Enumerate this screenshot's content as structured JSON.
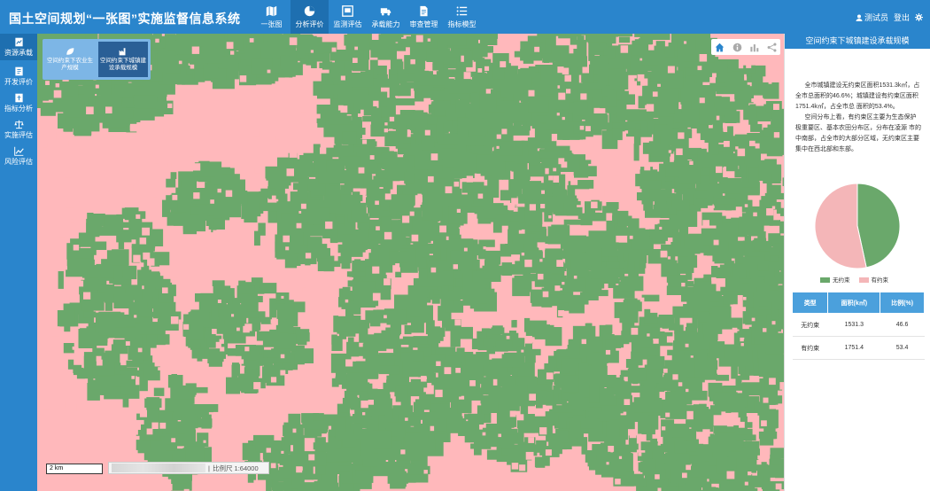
{
  "header": {
    "title": "国土空间规划“一张图”实施监督信息系统",
    "nav": [
      {
        "label": "一张图",
        "icon": "map-icon",
        "active": false
      },
      {
        "label": "分析评价",
        "icon": "pie-chart-icon",
        "active": true
      },
      {
        "label": "监测评估",
        "icon": "monitor-icon",
        "active": false
      },
      {
        "label": "承载能力",
        "icon": "truck-icon",
        "active": false
      },
      {
        "label": "审查管理",
        "icon": "document-icon",
        "active": false
      },
      {
        "label": "指标模型",
        "icon": "list-icon",
        "active": false
      }
    ],
    "user": "测试员",
    "logout": "登出"
  },
  "sidebar": {
    "items": [
      {
        "label": "资源承载",
        "icon": "resource-icon",
        "active": true
      },
      {
        "label": "开发评价",
        "icon": "dev-eval-icon",
        "active": false
      },
      {
        "label": "指标分析",
        "icon": "index-analysis-icon",
        "active": false
      },
      {
        "label": "实施评估",
        "icon": "balance-scale-icon",
        "active": false
      },
      {
        "label": "风险评估",
        "icon": "trend-chart-icon",
        "active": false
      }
    ]
  },
  "map": {
    "tabs": [
      {
        "label": "空间约束下农业生产规模",
        "icon": "leaf-icon",
        "active": false
      },
      {
        "label": "空间约束下城镇建设承载规模",
        "icon": "factory-icon",
        "active": true
      }
    ],
    "scale_bar": "2 km",
    "scale_text": "比例尺 1:64000",
    "colors": {
      "constrained": "#ffb8bb",
      "unconstrained": "#6aa86b"
    }
  },
  "panel": {
    "title": "空间约束下城镇建设承载规模",
    "paragraph1": "全市城镇建设无约束区面积1531.3k㎡，占全市总面积的46.6%；城镇建设有约束区面积1751.4k㎡，占全市总 面积的53.4%。",
    "paragraph2": "空间分布上看，有约束区主要为生态保护极重要区、基本农田分布区，分布在凌源 市的中南部，占全市的大部分区域，无约束区主要集中在西北部和东部。",
    "legend": [
      {
        "label": "无约束",
        "color": "#6aa86b"
      },
      {
        "label": "有约束",
        "color": "#f4b6b8"
      }
    ],
    "table": {
      "headers": [
        "类型",
        "面积(k㎡)",
        "比例(%)"
      ],
      "rows": [
        [
          "无约束",
          "1531.3",
          "46.6"
        ],
        [
          "有约束",
          "1751.4",
          "53.4"
        ]
      ]
    }
  },
  "chart_data": {
    "type": "pie",
    "categories": [
      "无约束",
      "有约束"
    ],
    "values": [
      46.6,
      53.4
    ],
    "colors": [
      "#6aa86b",
      "#f4b6b8"
    ]
  }
}
